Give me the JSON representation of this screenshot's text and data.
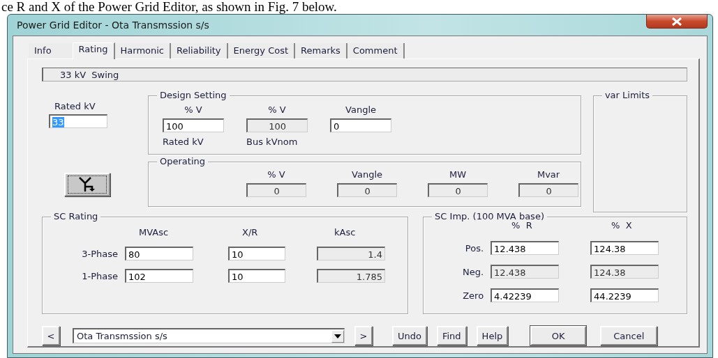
{
  "caption": "ce R and X of the Power Grid Editor, as shown in Fig. 7 below.",
  "window": {
    "title": "Power Grid Editor - Ota Transmssion s/s"
  },
  "tabs": [
    {
      "label": "Info",
      "selected": false
    },
    {
      "label": "Rating",
      "selected": true
    },
    {
      "label": "Harmonic",
      "selected": false
    },
    {
      "label": "Reliability",
      "selected": false
    },
    {
      "label": "Energy Cost",
      "selected": false
    },
    {
      "label": "Remarks",
      "selected": false
    },
    {
      "label": "Comment",
      "selected": false
    }
  ],
  "status_field": "33 kV  Swing",
  "rated_kv": {
    "label": "Rated kV",
    "value": "33",
    "text_selected": true
  },
  "design_setting": {
    "title": "Design Setting",
    "fields": [
      {
        "label": "% V",
        "value": "100",
        "editable": true,
        "caption": "Rated kV"
      },
      {
        "label": "% V",
        "value": "100",
        "editable": false,
        "caption": "Bus kVnom"
      },
      {
        "label": "Vangle",
        "value": "0",
        "editable": true
      }
    ]
  },
  "operating": {
    "title": "Operating",
    "fields": [
      {
        "label": "% V",
        "value": "0",
        "editable": false
      },
      {
        "label": "Vangle",
        "value": "0",
        "editable": false
      },
      {
        "label": "MW",
        "value": "0",
        "editable": false
      },
      {
        "label": "Mvar",
        "value": "0",
        "editable": false
      }
    ]
  },
  "var_limits": {
    "title": "var Limits"
  },
  "sc_rating": {
    "title": "SC Rating",
    "columns": [
      "MVAsc",
      "X/R",
      "kAsc"
    ],
    "rows": [
      {
        "label": "3-Phase",
        "cells": [
          {
            "value": "80",
            "editable": true
          },
          {
            "value": "10",
            "editable": true
          },
          {
            "value": "1.4",
            "editable": false
          }
        ]
      },
      {
        "label": "1-Phase",
        "cells": [
          {
            "value": "102",
            "editable": true
          },
          {
            "value": "10",
            "editable": true
          },
          {
            "value": "1.785",
            "editable": false
          }
        ]
      }
    ]
  },
  "sc_imp": {
    "title": "SC Imp. (100 MVA base)",
    "columns": [
      "%  R",
      "%  X"
    ],
    "rows": [
      {
        "label": "Pos.",
        "cells": [
          {
            "value": "12.438",
            "editable": true
          },
          {
            "value": "124.38",
            "editable": true
          }
        ]
      },
      {
        "label": "Neg.",
        "cells": [
          {
            "value": "12.438",
            "editable": false
          },
          {
            "value": "124.38",
            "editable": false
          }
        ]
      },
      {
        "label": "Zero",
        "cells": [
          {
            "value": "4.42239",
            "editable": true
          },
          {
            "value": "44.2239",
            "editable": true
          }
        ]
      }
    ]
  },
  "navigator": {
    "prev": "<",
    "combo": "Ota Transmssion s/s",
    "next": ">"
  },
  "buttons": [
    {
      "label": "Undo",
      "default": false
    },
    {
      "label": "Find",
      "default": false
    },
    {
      "label": "Help",
      "default": false
    },
    {
      "label": "OK",
      "default": true
    },
    {
      "label": "Cancel",
      "default": false
    }
  ]
}
